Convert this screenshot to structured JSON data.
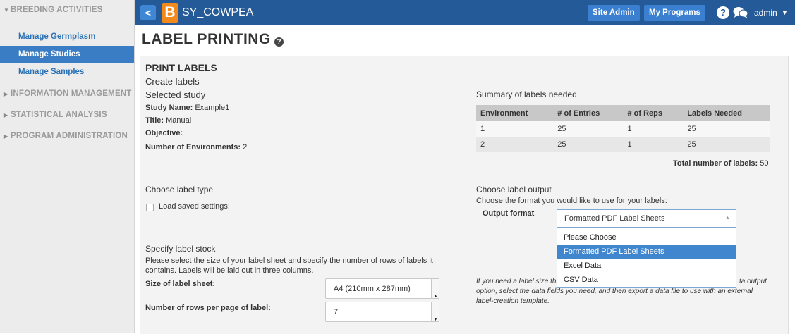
{
  "sidebar": {
    "sections": [
      {
        "label": "BREEDING ACTIVITIES",
        "expanded": true
      },
      {
        "label": "INFORMATION MANAGEMENT",
        "expanded": false
      },
      {
        "label": "STATISTICAL ANALYSIS",
        "expanded": false
      },
      {
        "label": "PROGRAM ADMINISTRATION",
        "expanded": false
      }
    ],
    "items": [
      {
        "label": "Manage Germplasm",
        "active": false
      },
      {
        "label": "Manage Studies",
        "active": true
      },
      {
        "label": "Manage Samples",
        "active": false
      }
    ]
  },
  "topbar": {
    "back_glyph": "<",
    "logo_letter": "B",
    "app_name": "SY_COWPEA",
    "site_admin": "Site Admin",
    "my_programs": "My Programs",
    "help_glyph": "?",
    "user": "admin",
    "colors": {
      "bar": "#235a97",
      "button": "#3a7fd0",
      "logo": "#f1891d"
    }
  },
  "page": {
    "title": "LABEL PRINTING",
    "help_glyph": "?"
  },
  "print_labels": {
    "heading": "PRINT LABELS",
    "create_labels": "Create labels",
    "selected_study_heading": "Selected study",
    "study_name_label": "Study Name:",
    "study_name_value": "Example1",
    "title_label": "Title:",
    "title_value": "Manual",
    "objective_label": "Objective:",
    "objective_value": "",
    "num_env_label": "Number of Environments:",
    "num_env_value": "2"
  },
  "summary": {
    "heading": "Summary of labels needed",
    "columns": [
      "Environment",
      "# of Entries",
      "# of Reps",
      "Labels Needed"
    ],
    "rows": [
      [
        "1",
        "25",
        "1",
        "25"
      ],
      [
        "2",
        "25",
        "1",
        "25"
      ]
    ],
    "total_label": "Total number of labels:",
    "total_value": "50"
  },
  "label_type": {
    "heading": "Choose label type",
    "load_saved_label": "Load saved settings:",
    "load_saved_checked": false
  },
  "label_output": {
    "heading": "Choose label output",
    "description": "Choose the format you would like to use for your labels:",
    "output_format_label": "Output format",
    "selected": "Formatted PDF Label Sheets",
    "options": [
      "Please Choose",
      "Formatted PDF Label Sheets",
      "Excel Data",
      "CSV Data"
    ],
    "note_left": "If you need a label size th",
    "note_right": "ta output",
    "note_line2": "option, select the data fields you need, and then export a data file to use with an external",
    "note_line3": "label-creation template."
  },
  "label_stock": {
    "heading": "Specify label stock",
    "description_line1": "Please select the size of your label sheet and specify the number of rows of labels it",
    "description_line2": "contains. Labels will be laid out in three columns.",
    "sheet_size_label": "Size of label sheet:",
    "sheet_size_value": "A4 (210mm x 287mm)",
    "rows_label": "Number of rows per page of label:",
    "rows_value": "7"
  }
}
